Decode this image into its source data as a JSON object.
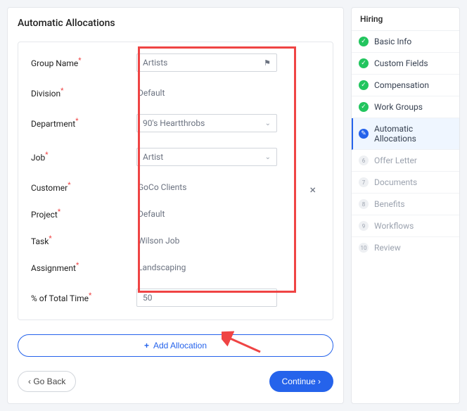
{
  "page": {
    "title": "Automatic Allocations"
  },
  "form": {
    "groupName": {
      "label": "Group Name",
      "value": "Artists"
    },
    "division": {
      "label": "Division",
      "value": "Default"
    },
    "department": {
      "label": "Department",
      "value": "90's Heartthrobs"
    },
    "job": {
      "label": "Job",
      "value": "Artist"
    },
    "customer": {
      "label": "Customer",
      "value": "GoCo Clients"
    },
    "project": {
      "label": "Project",
      "value": "Default"
    },
    "task": {
      "label": "Task",
      "value": "Wilson Job"
    },
    "assignment": {
      "label": "Assignment",
      "value": "Landscaping"
    },
    "percentTime": {
      "label": "% of Total Time",
      "value": "50"
    }
  },
  "buttons": {
    "addAllocation": "Add Allocation",
    "goBack": "Go Back",
    "continue": "Continue"
  },
  "sidebar": {
    "header": "Hiring",
    "items": [
      {
        "label": "Basic Info",
        "state": "done"
      },
      {
        "label": "Custom Fields",
        "state": "done"
      },
      {
        "label": "Compensation",
        "state": "done"
      },
      {
        "label": "Work Groups",
        "state": "done"
      },
      {
        "label": "Automatic Allocations",
        "state": "active"
      },
      {
        "label": "Offer Letter",
        "state": "pending",
        "num": "6"
      },
      {
        "label": "Documents",
        "state": "pending",
        "num": "7"
      },
      {
        "label": "Benefits",
        "state": "pending",
        "num": "8"
      },
      {
        "label": "Workflows",
        "state": "pending",
        "num": "9"
      },
      {
        "label": "Review",
        "state": "pending",
        "num": "10"
      }
    ]
  }
}
